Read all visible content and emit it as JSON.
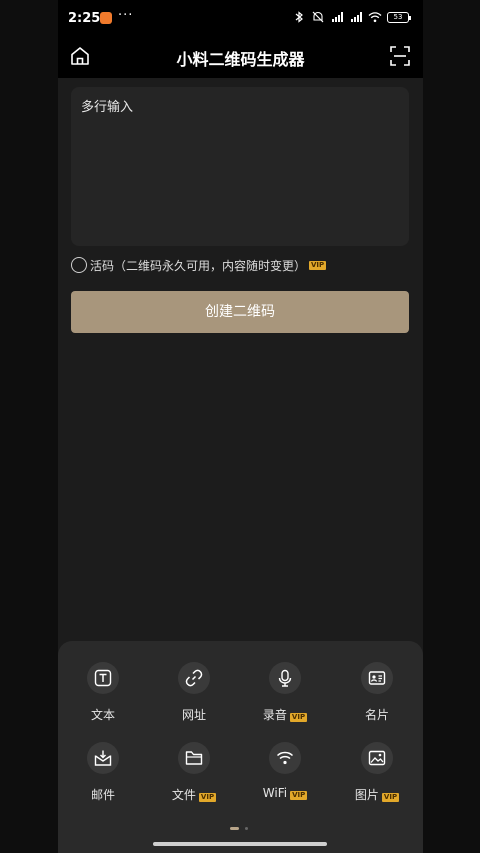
{
  "status_bar": {
    "time": "2:25",
    "dots": "···",
    "battery": "53"
  },
  "header": {
    "title": "小料二维码生成器"
  },
  "input": {
    "placeholder": "多行输入"
  },
  "live_code": {
    "label": "活码（二维码永久可用，内容随时变更）",
    "vip": "VIP"
  },
  "create_button": "创建二维码",
  "tools": [
    {
      "label": "文本",
      "icon": "text-icon",
      "vip": ""
    },
    {
      "label": "网址",
      "icon": "link-icon",
      "vip": ""
    },
    {
      "label": "录音",
      "icon": "microphone-icon",
      "vip": "VIP"
    },
    {
      "label": "名片",
      "icon": "contact-card-icon",
      "vip": ""
    },
    {
      "label": "邮件",
      "icon": "mail-icon",
      "vip": ""
    },
    {
      "label": "文件",
      "icon": "folder-icon",
      "vip": "VIP"
    },
    {
      "label": "WiFi",
      "icon": "wifi-icon",
      "vip": "VIP"
    },
    {
      "label": "图片",
      "icon": "image-icon",
      "vip": "VIP"
    }
  ],
  "colors": {
    "accent": "#a8967c",
    "vip": "#e2a82a",
    "background": "#1c1c1c"
  }
}
